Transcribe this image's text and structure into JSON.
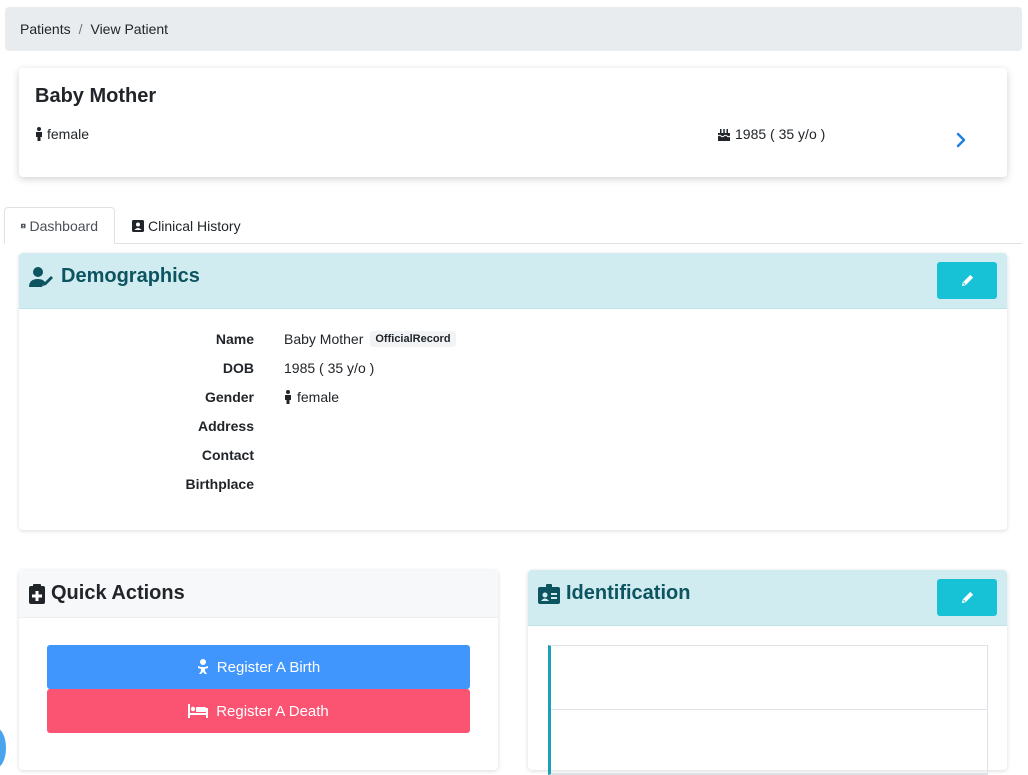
{
  "breadcrumb": {
    "parent": "Patients",
    "separator": "/",
    "current": "View Patient"
  },
  "patient": {
    "name": "Baby Mother",
    "gender": "female",
    "dob": "1985 ( 35 y/o )"
  },
  "tabs": [
    {
      "label": "Dashboard",
      "active": true
    },
    {
      "label": "Clinical History",
      "active": false
    }
  ],
  "demographics": {
    "title": "Demographics",
    "rows": [
      {
        "label": "Name",
        "value": "Baby Mother",
        "badge": "OfficialRecord"
      },
      {
        "label": "DOB",
        "value": "1985 ( 35 y/o )"
      },
      {
        "label": "Gender",
        "value": "female"
      },
      {
        "label": "Address",
        "value": ""
      },
      {
        "label": "Contact",
        "value": ""
      },
      {
        "label": "Birthplace",
        "value": ""
      }
    ]
  },
  "quick_actions": {
    "title": "Quick Actions",
    "birth_label": "Register A Birth",
    "death_label": "Register A Death"
  },
  "identification": {
    "title": "Identification"
  },
  "colors": {
    "teal_header": "#d1ecf1",
    "teal_text": "#0c5460",
    "edit_button": "#17c1d6",
    "birth_button": "#4096fc",
    "death_button": "#fb5472",
    "link_blue": "#1e7fe0"
  },
  "icons": {
    "gender": "female-figure-icon",
    "dob": "birthday-cake-icon",
    "chevron": "chevron-right-icon",
    "dashboard_tab": "user-card-icon",
    "history_tab": "medical-card-icon",
    "demographics": "user-edit-icon",
    "edit": "pencil-icon",
    "quick_actions": "clipboard-plus-icon",
    "birth": "baby-icon",
    "death": "bed-icon",
    "identification": "id-badge-icon"
  }
}
